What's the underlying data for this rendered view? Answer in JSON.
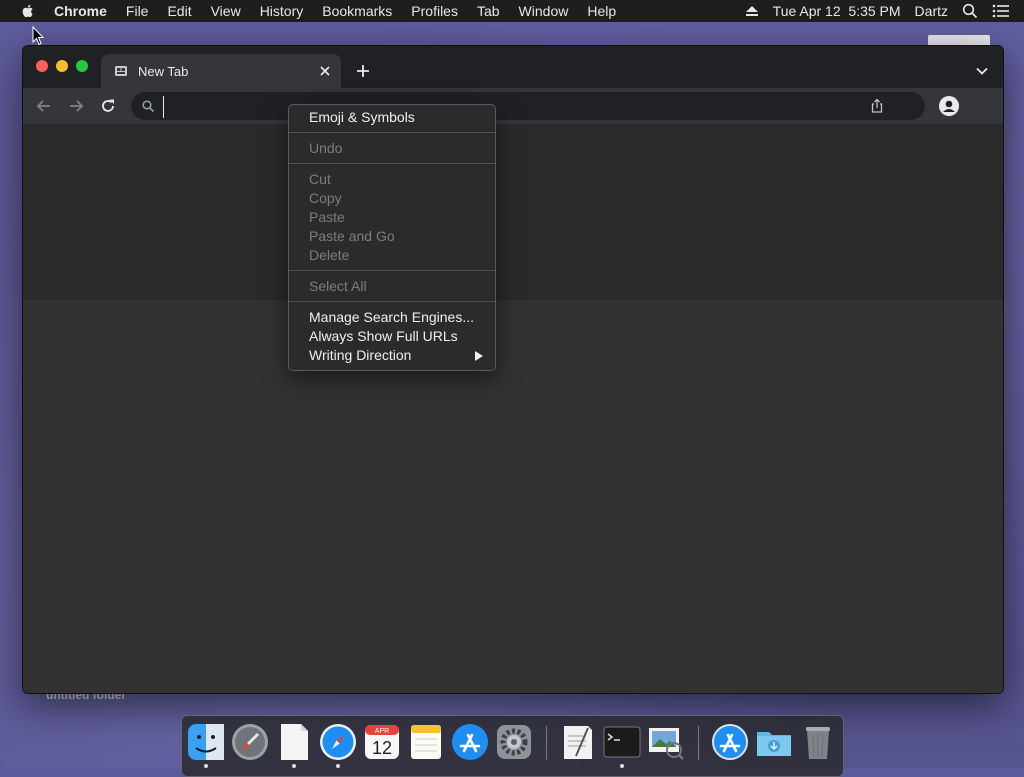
{
  "menubar": {
    "app_name": "Chrome",
    "items": [
      "File",
      "Edit",
      "View",
      "History",
      "Bookmarks",
      "Profiles",
      "Tab",
      "Window",
      "Help"
    ],
    "datetime": "Tue Apr 12  5:35 PM",
    "user": "Dartz",
    "icons": [
      "apple-icon",
      "eject-icon",
      "spotlight-search-icon",
      "control-center-list-icon"
    ]
  },
  "desktop": {
    "folder_label": "untitled folder"
  },
  "browser": {
    "tab_title": "New Tab",
    "omnibox_value": "",
    "colors": {
      "tabstrip": "#202124",
      "toolbar": "#35363a",
      "page": "#323233"
    }
  },
  "context_menu": {
    "items": [
      {
        "label": "Emoji & Symbols",
        "enabled": true
      },
      {
        "label": "Undo",
        "enabled": false
      },
      {
        "label": "Cut",
        "enabled": false
      },
      {
        "label": "Copy",
        "enabled": false
      },
      {
        "label": "Paste",
        "enabled": false
      },
      {
        "label": "Paste and Go",
        "enabled": false
      },
      {
        "label": "Delete",
        "enabled": false
      },
      {
        "label": "Select All",
        "enabled": false
      },
      {
        "label": "Manage Search Engines...",
        "enabled": true
      },
      {
        "label": "Always Show Full URLs",
        "enabled": true
      },
      {
        "label": "Writing Direction",
        "enabled": true,
        "submenu": true
      }
    ]
  },
  "dock": {
    "apps": [
      "Finder",
      "Launchpad",
      "Document",
      "Safari",
      "Calendar",
      "Notes",
      "App Store",
      "System Preferences",
      "TextEdit",
      "Terminal",
      "Preview",
      "App Store Downloads",
      "Downloads Folder",
      "Trash"
    ],
    "calendar_month": "APR",
    "calendar_day": "12"
  }
}
